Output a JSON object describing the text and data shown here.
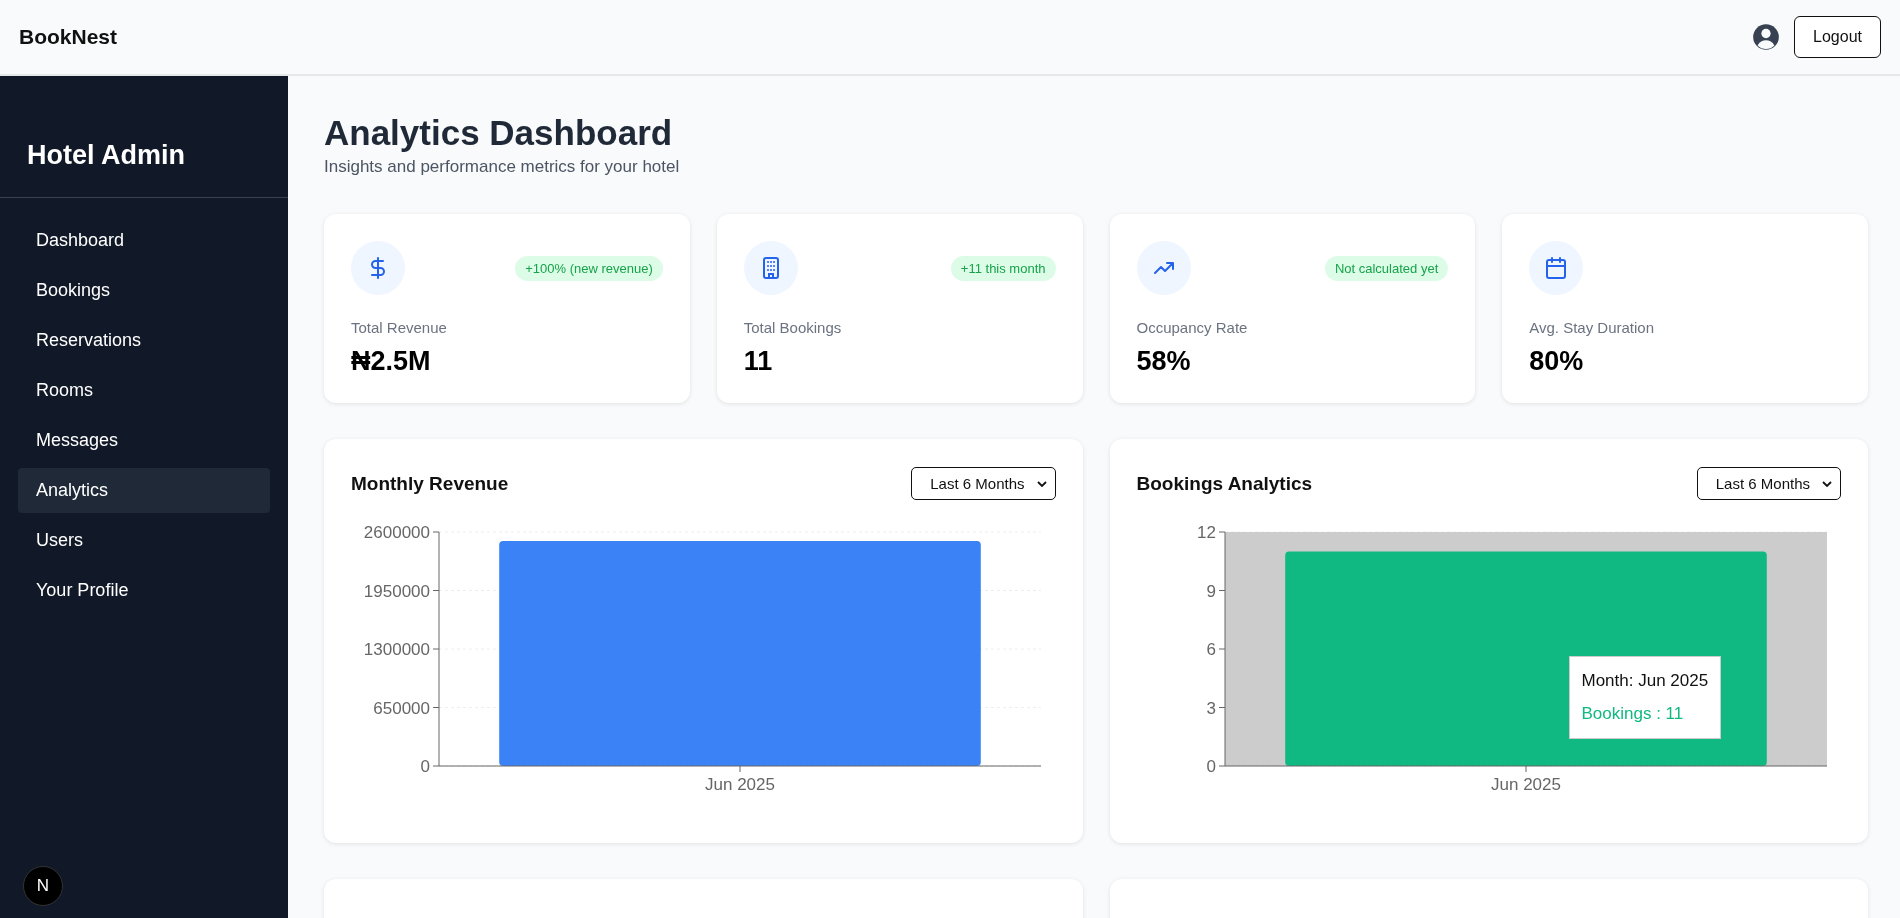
{
  "header": {
    "brand": "BookNest",
    "logout_button": "Logout"
  },
  "sidebar": {
    "title": "Hotel Admin",
    "items": [
      {
        "label": "Dashboard",
        "selected": false
      },
      {
        "label": "Bookings",
        "selected": false
      },
      {
        "label": "Reservations",
        "selected": false
      },
      {
        "label": "Rooms",
        "selected": false
      },
      {
        "label": "Messages",
        "selected": false
      },
      {
        "label": "Analytics",
        "selected": true
      },
      {
        "label": "Users",
        "selected": false
      },
      {
        "label": "Your Profile",
        "selected": false
      }
    ],
    "dev_badge": "N"
  },
  "page": {
    "title": "Analytics Dashboard",
    "subtitle": "Insights and performance metrics for your hotel"
  },
  "stats": [
    {
      "kind": "revenue",
      "badge": "+100% (new revenue)",
      "label": "Total Revenue",
      "value": "₦2.5M"
    },
    {
      "kind": "bookings",
      "badge": "+11 this month",
      "label": "Total Bookings",
      "value": "11"
    },
    {
      "kind": "occupancy",
      "badge": "Not calculated yet",
      "label": "Occupancy Rate",
      "value": "58%"
    },
    {
      "kind": "stay",
      "label": "Avg. Stay Duration",
      "value": "80%"
    }
  ],
  "charts": [
    {
      "title": "Monthly Revenue",
      "range": "Last 6 Months",
      "hovered": false,
      "chart_data": {
        "type": "bar",
        "grid": true,
        "categories": [
          "Jun 2025"
        ],
        "series": [
          {
            "color": "#3b82f6",
            "values": [
              2500000
            ]
          }
        ],
        "ylim": [
          0,
          2600000
        ],
        "yticks": [
          0,
          650000,
          1300000,
          1950000,
          2600000
        ]
      }
    },
    {
      "title": "Bookings Analytics",
      "range": "Last 6 Months",
      "hovered": true,
      "tooltip": {
        "heading": "Month: Jun 2025",
        "value": "Bookings : 11"
      },
      "chart_data": {
        "type": "bar",
        "grid": true,
        "categories": [
          "Jun 2025"
        ],
        "series": [
          {
            "color": "#10b981",
            "values": [
              11
            ]
          }
        ],
        "ylim": [
          0,
          12
        ],
        "yticks": [
          0,
          3,
          6,
          9,
          12
        ]
      }
    }
  ]
}
